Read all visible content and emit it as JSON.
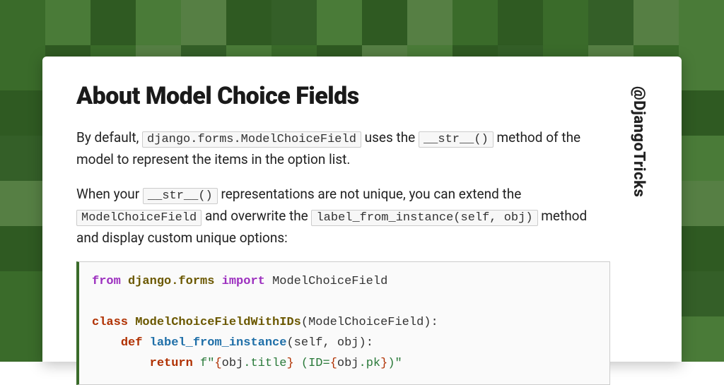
{
  "title": "About Model Choice Fields",
  "handle": "@DjangoTricks",
  "para1": {
    "t0": "By default, ",
    "c0": "django.forms.ModelChoiceField",
    "t1": " uses the ",
    "c1": "__str__()",
    "t2": " method of the model to represent the items in the option list."
  },
  "para2": {
    "t0": "When your ",
    "c0": "__str__()",
    "t1": " representations are not unique, you can extend the ",
    "c1": "ModelChoiceField",
    "t2": " and overwrite the ",
    "c2": "label_from_instance(self, obj)",
    "t3": " method and display custom unique options:"
  },
  "code": {
    "from": "from",
    "module": "django.forms",
    "import": "import",
    "import_name": "ModelChoiceField",
    "class_kw": "class",
    "class_name": "ModelChoiceFieldWithIDs",
    "class_base": "ModelChoiceField",
    "def_kw": "def",
    "fn_name": "label_from_instance",
    "params": "self, obj",
    "return_kw": "return",
    "str_a": "f\"",
    "br_o1": "{",
    "expr1a": "obj",
    "expr1b": ".title",
    "br_c1": "}",
    "str_b": " (ID=",
    "br_o2": "{",
    "expr2a": "obj",
    "expr2b": ".pk",
    "br_c2": "}",
    "str_c": ")\""
  }
}
